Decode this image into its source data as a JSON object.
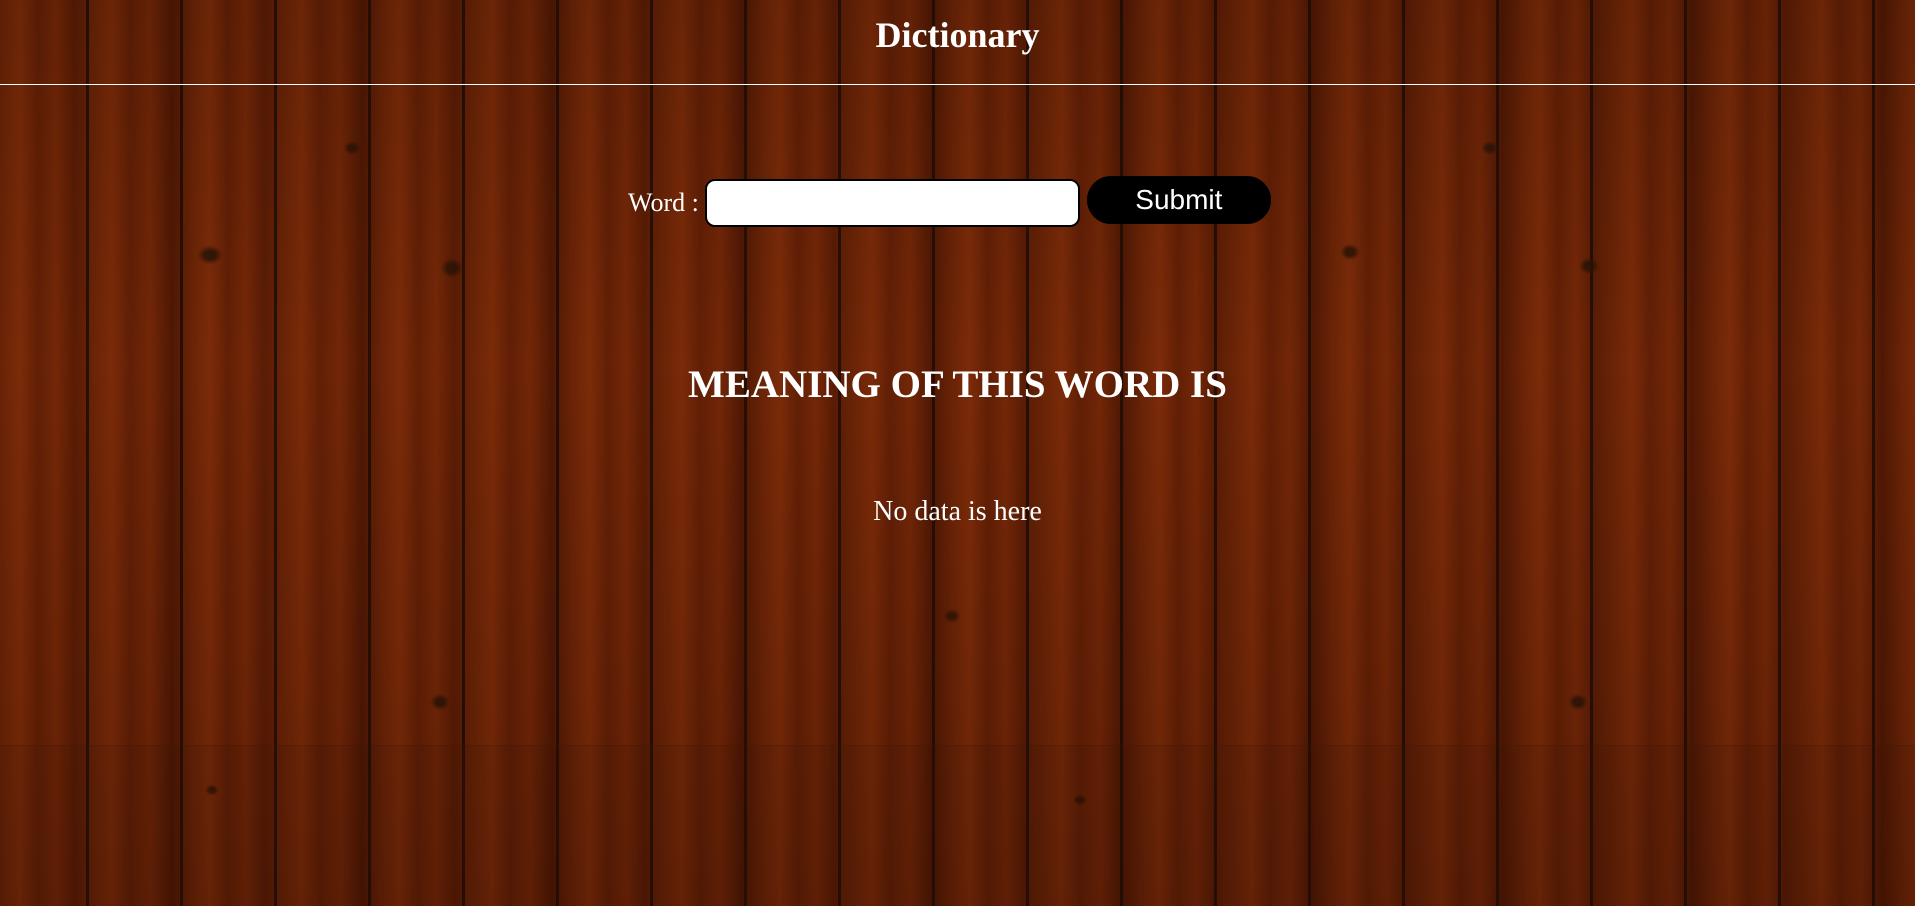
{
  "header": {
    "title": "Dictionary"
  },
  "form": {
    "word_label": "Word :",
    "word_value": "",
    "word_placeholder": "",
    "submit_label": "Submit"
  },
  "result": {
    "heading": "MEANING OF THIS WORD IS",
    "text": "No data is here"
  },
  "colors": {
    "text": "#ffffff",
    "button_background": "#000000",
    "input_background": "#ffffff",
    "header_rule": "#ffffff"
  },
  "background": "wood-planks"
}
